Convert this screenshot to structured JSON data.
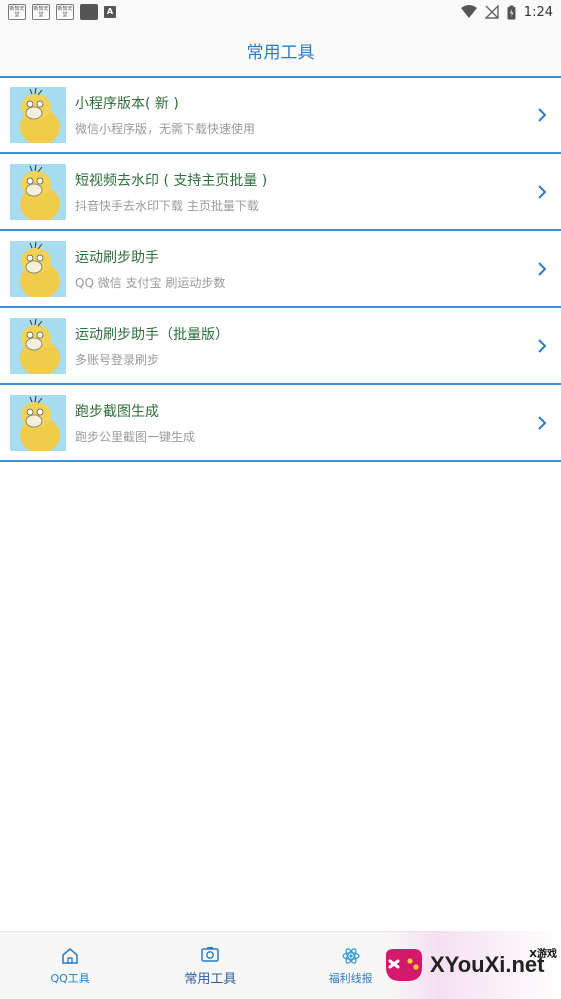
{
  "status_bar": {
    "notif_box_1": "新知天堂",
    "notif_box_2": "新知天堂",
    "notif_box_3": "新知天堂",
    "notif_letter": "A",
    "time": "1:24"
  },
  "header": {
    "title": "常用工具"
  },
  "tools": [
    {
      "title": "小程序版本( 新 )",
      "subtitle": "微信小程序版，无需下载快速使用"
    },
    {
      "title": "短视频去水印 ( 支持主页批量 )",
      "subtitle": "抖音快手去水印下载 主页批量下载"
    },
    {
      "title": "运动刷步助手",
      "subtitle": "QQ 微信 支付宝 刷运动步数"
    },
    {
      "title": "运动刷步助手（批量版）",
      "subtitle": "多账号登录刷步"
    },
    {
      "title": "跑步截图生成",
      "subtitle": "跑步公里截图一键生成"
    }
  ],
  "tabbar": {
    "tabs": [
      {
        "label": "QQ工具",
        "icon": "home-icon"
      },
      {
        "label": "常用工具",
        "icon": "camera-icon"
      },
      {
        "label": "福利线报",
        "icon": "atom-icon"
      }
    ]
  },
  "watermark": {
    "text": "XYouXi.net",
    "small": "X游戏"
  },
  "colors": {
    "accent": "#2a7cc6",
    "divider": "#3d8fd6",
    "title_green": "#2e6e3a",
    "thumb_bg": "#a8dcf0"
  }
}
